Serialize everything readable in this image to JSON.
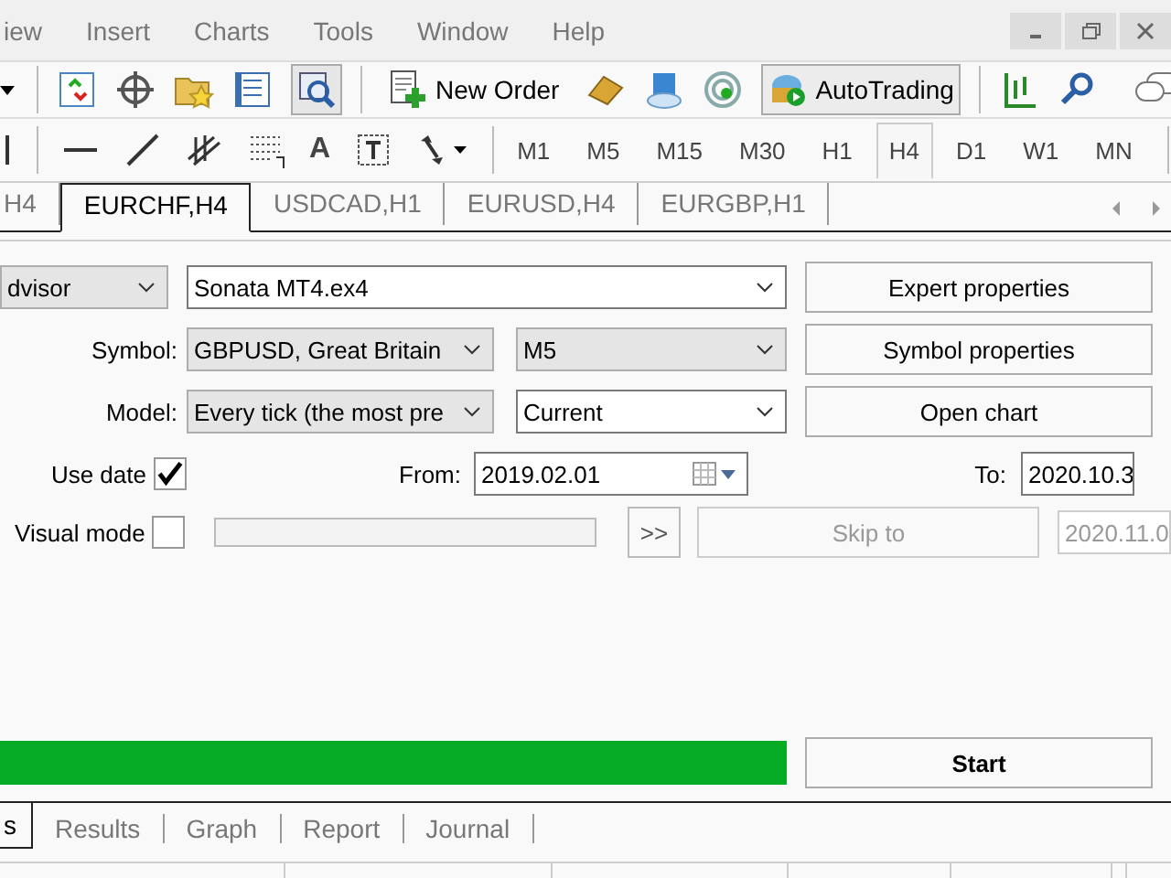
{
  "menu": [
    {
      "label": "iew"
    },
    {
      "label": "Insert"
    },
    {
      "label": "Charts"
    },
    {
      "label": "Tools"
    },
    {
      "label": "Window"
    },
    {
      "label": "Help"
    }
  ],
  "toolbar": {
    "zoom_pressed": true,
    "new_order": "New Order",
    "autotrading": {
      "label": "AutoTrading",
      "on": true
    }
  },
  "drawing_toolbar": {
    "text_tool": "A"
  },
  "timeframes": [
    {
      "label": "M1",
      "selected": false
    },
    {
      "label": "M5",
      "selected": false
    },
    {
      "label": "M15",
      "selected": false
    },
    {
      "label": "M30",
      "selected": false
    },
    {
      "label": "H1",
      "selected": false
    },
    {
      "label": "H4",
      "selected": true
    },
    {
      "label": "D1",
      "selected": false
    },
    {
      "label": "W1",
      "selected": false
    },
    {
      "label": "MN",
      "selected": false
    }
  ],
  "chart_tabs": [
    {
      "label": "H4",
      "selected": false
    },
    {
      "label": "EURCHF,H4",
      "selected": true
    },
    {
      "label": "USDCAD,H1",
      "selected": false
    },
    {
      "label": "EURUSD,H4",
      "selected": false
    },
    {
      "label": "EURGBP,H1",
      "selected": false
    }
  ],
  "tester": {
    "mode": "dvisor",
    "expert": "Sonata MT4.ex4",
    "symbol_label": "Symbol:",
    "symbol": "GBPUSD, Great Britain",
    "period": "M5",
    "model_label": "Model:",
    "model": "Every tick (the most pre",
    "spread": "Current",
    "buttons": {
      "expert_properties": "Expert properties",
      "symbol_properties": "Symbol properties",
      "open_chart": "Open chart"
    },
    "use_date": {
      "label": "Use date",
      "checked": true
    },
    "from_label": "From:",
    "from": "2019.02.01",
    "to_label": "To:",
    "to": "2020.10.3",
    "visual_mode": {
      "label": "Visual mode",
      "checked": false
    },
    "skip_button": ">>",
    "skip_to": "Skip to",
    "skip_date": "2020.11.0",
    "progress": {
      "level": 1
    },
    "start": "Start"
  },
  "bottom_tabs": [
    {
      "label": "s",
      "selected": true
    },
    {
      "label": "Results",
      "selected": false
    },
    {
      "label": "Graph",
      "selected": false
    },
    {
      "label": "Report",
      "selected": false
    },
    {
      "label": "Journal",
      "selected": false
    }
  ]
}
